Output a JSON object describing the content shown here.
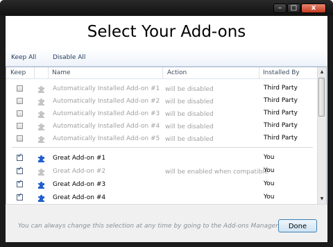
{
  "window": {
    "caption_buttons": {
      "minimize": "–",
      "maximize": "□",
      "close": "x"
    }
  },
  "heading": "Select Your Add-ons",
  "toolbar": {
    "keep_all": "Keep All",
    "disable_all": "Disable All"
  },
  "columns": {
    "keep": "Keep",
    "name": "Name",
    "action": "Action",
    "installed_by": "Installed By"
  },
  "rows": [
    {
      "name": "Automatically Installed Add-on #1",
      "action": "will be disabled",
      "installed_by": "Third Party",
      "checked": false,
      "icon": "puzzle-piece-gray-icon"
    },
    {
      "name": "Automatically Installed Add-on #2",
      "action": "will be disabled",
      "installed_by": "Third Party",
      "checked": false,
      "icon": "puzzle-piece-gray-icon"
    },
    {
      "name": "Automatically Installed Add-on #3",
      "action": "will be disabled",
      "installed_by": "Third Party",
      "checked": false,
      "icon": "puzzle-piece-gray-icon"
    },
    {
      "name": "Automatically Installed Add-on #4",
      "action": "will be disabled",
      "installed_by": "Third Party",
      "checked": false,
      "icon": "puzzle-piece-gray-icon"
    },
    {
      "name": "Automatically Installed Add-on #5",
      "action": "will be disabled",
      "installed_by": "Third Party",
      "checked": false,
      "icon": "puzzle-piece-gray-icon"
    },
    {
      "name": "Great Add-on #1",
      "action": "",
      "installed_by": "You",
      "checked": true,
      "icon": "puzzle-piece-blue-icon"
    },
    {
      "name": "Great Add-on #2",
      "action": "will be enabled when compatible",
      "installed_by": "You",
      "checked": true,
      "icon": "puzzle-piece-gray-icon"
    },
    {
      "name": "Great Add-on #3",
      "action": "",
      "installed_by": "You",
      "checked": true,
      "icon": "puzzle-piece-blue-icon"
    },
    {
      "name": "Great Add-on #4",
      "action": "",
      "installed_by": "You",
      "checked": true,
      "icon": "puzzle-piece-blue-icon"
    }
  ],
  "checkmark": "✓",
  "footer": {
    "hint": "You can always change this selection at any time by going to the Add-ons Manager",
    "done": "Done"
  },
  "colors": {
    "accent_blue": "#1f5fcf",
    "disabled_gray": "#a0a0a0",
    "close_red": "#c33a1f"
  }
}
